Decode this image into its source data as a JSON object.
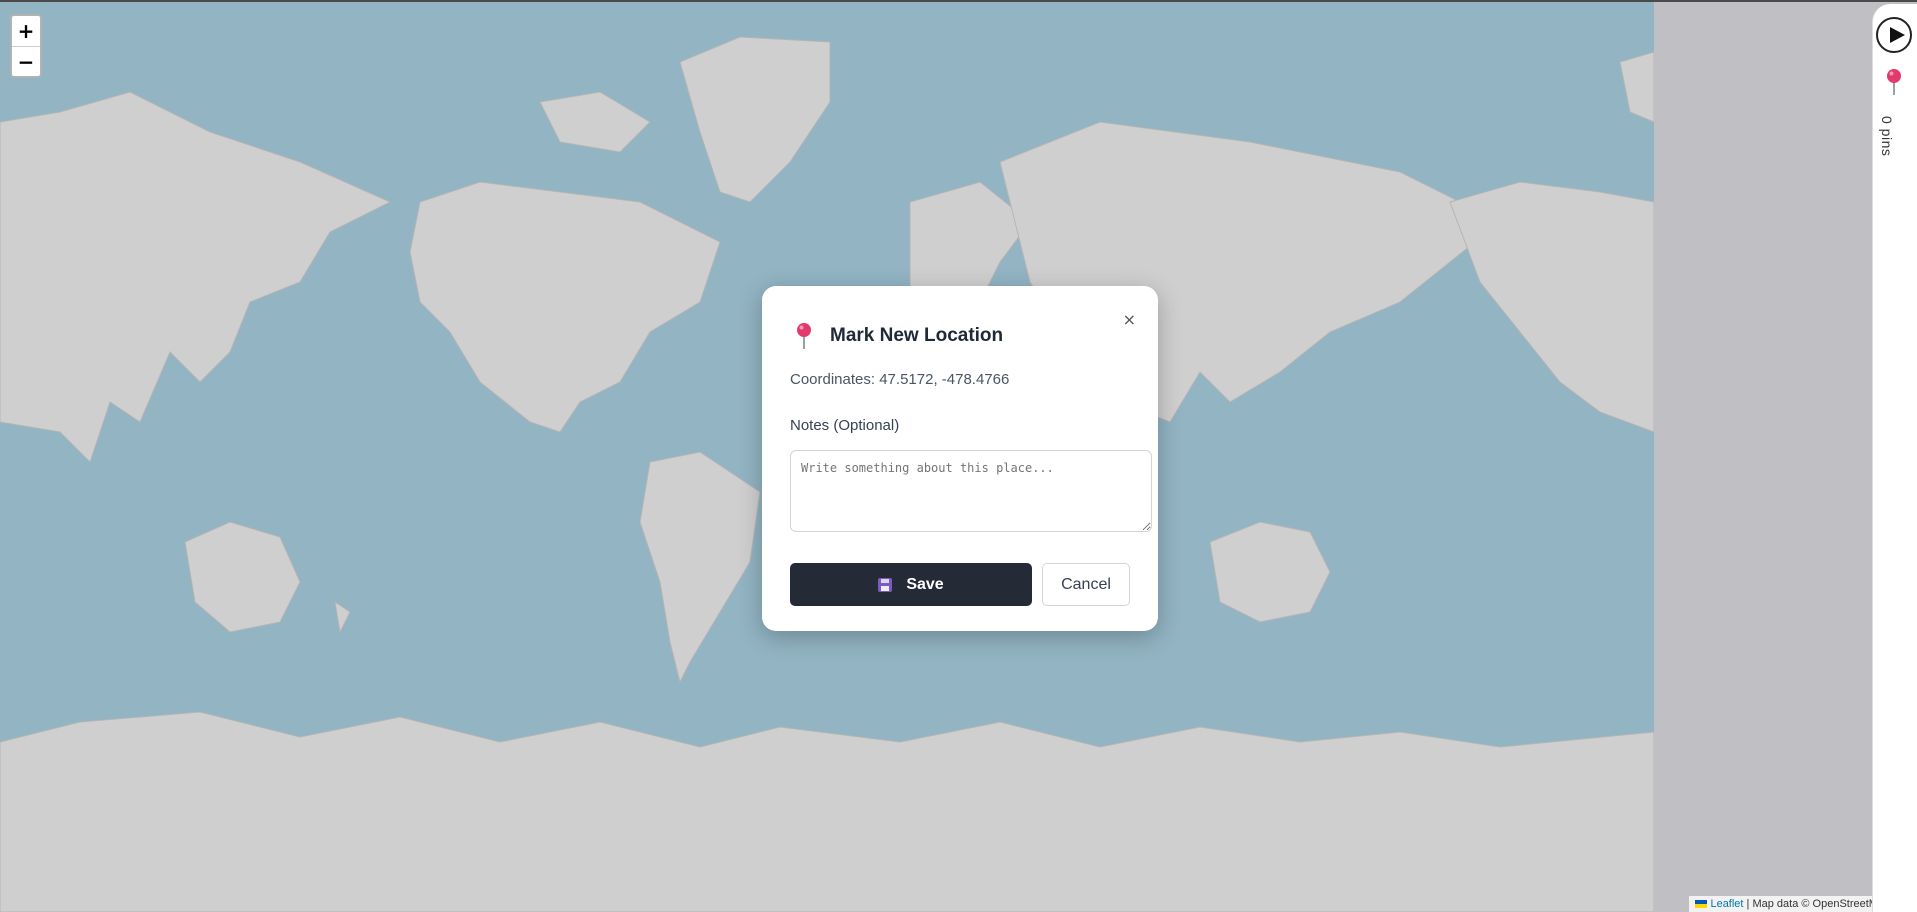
{
  "map": {
    "zoom_in_label": "+",
    "zoom_out_label": "−",
    "attribution_link": "Leaflet",
    "attribution_text": "| Map data © OpenStreetMap con",
    "colors": {
      "water": "#92b4c3",
      "land": "#cfcfcf",
      "border": "#a8a8a8"
    }
  },
  "side_panel": {
    "pins_label": "0 pins",
    "play_icon": "play-icon",
    "pin_icon": "pushpin-icon"
  },
  "dialog": {
    "title": "Mark New Location",
    "close_label": "×",
    "coordinates_text": "Coordinates: 47.5172, -478.4766",
    "notes_label": "Notes (Optional)",
    "notes_placeholder": "Write something about this place...",
    "notes_value": "",
    "save_label": "Save",
    "cancel_label": "Cancel",
    "colors": {
      "accent": "#242b37",
      "pin": "#e23a6a"
    }
  }
}
